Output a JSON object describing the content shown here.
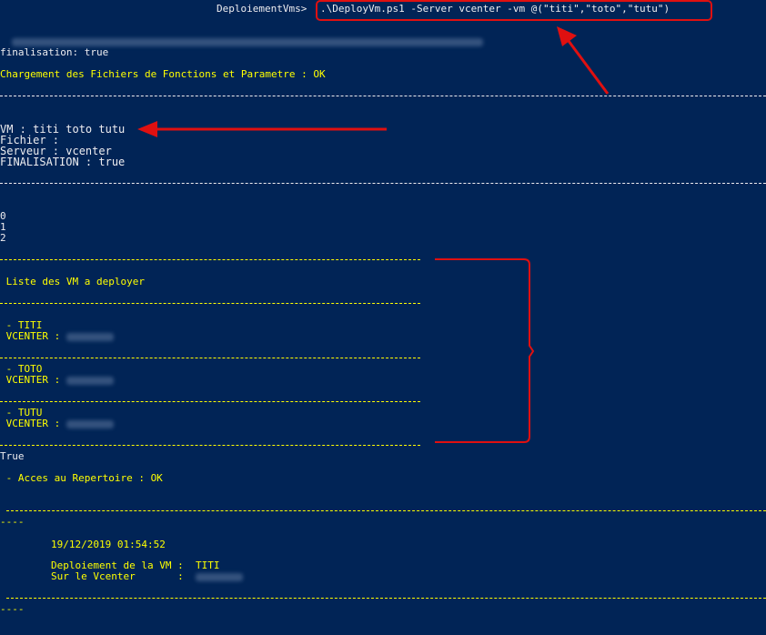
{
  "prompt": {
    "path": "DeploiementVms> ",
    "command": ".\\DeployVm.ps1 -Server vcenter -vm @(\"titi\",\"toto\",\"tutu\")"
  },
  "output": {
    "finalisation_line": "finalisation: true",
    "chargement": "Chargement des Fichiers de Fonctions et Parametre : OK",
    "vm_line": "VM : titi toto tutu",
    "fichier_line": "Fichier :",
    "serveur_line": "Serveur : vcenter",
    "final_upper": "FINALISATION : true",
    "indices": [
      "0",
      "1",
      "2"
    ],
    "liste_header": " Liste des VM a deployer",
    "vm_entries": [
      {
        "name": " - TITI",
        "vcenter_label": " VCENTER : "
      },
      {
        "name": " - TOTO",
        "vcenter_label": " VCENTER : "
      },
      {
        "name": " - TUTU",
        "vcenter_label": " VCENTER : "
      }
    ],
    "true_line": "True",
    "acces": " - Acces au Repertoire : OK",
    "dash_tail": "----",
    "timestamp": "19/12/2019 01:54:52",
    "deploy_label": "Deploiement de la VM :  ",
    "deploy_vm": "TITI",
    "sur_label": "Sur le Vcenter       :  ",
    "dash_tail2": "----"
  },
  "colors": {
    "background": "#012456",
    "text": "#eeedf0",
    "highlight": "#ffff00",
    "annotation": "#e01010"
  }
}
